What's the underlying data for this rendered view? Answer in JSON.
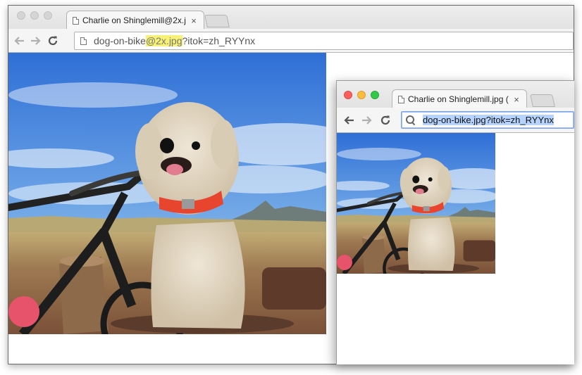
{
  "large_window": {
    "tab": {
      "title": "Charlie on Shinglemill@2x.j",
      "close_glyph": "×"
    },
    "address": {
      "prefix": "dog-on-bike",
      "highlight": "@2x.jpg",
      "suffix": "?itok=zh_RYYnx"
    }
  },
  "small_window": {
    "tab": {
      "title": "Charlie on Shinglemill.jpg (",
      "close_glyph": "×"
    },
    "address": {
      "selected": "dog-on-bike.jpg?itok=zh_RYYnx"
    }
  },
  "icons": {
    "back": "back-arrow-icon",
    "forward": "forward-arrow-icon",
    "reload": "reload-icon",
    "page": "page-icon",
    "search": "search-icon"
  },
  "colors": {
    "close_red": "#fc605c",
    "minimize_yellow": "#fdbc40",
    "zoom_green": "#34c84a",
    "url_highlight": "#f7f275",
    "selection_blue": "#b5d3fc"
  }
}
